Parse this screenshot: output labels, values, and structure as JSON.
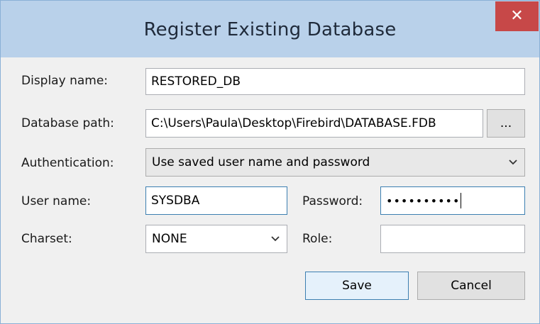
{
  "window": {
    "title": "Register Existing Database",
    "close_icon": "close-icon"
  },
  "form": {
    "display_name": {
      "label": "Display name:",
      "value": "RESTORED_DB"
    },
    "database_path": {
      "label": "Database path:",
      "value": "C:\\Users\\Paula\\Desktop\\Firebird\\DATABASE.FDB",
      "browse_label": "..."
    },
    "authentication": {
      "label": "Authentication:",
      "selected": "Use saved user name and password"
    },
    "user_name": {
      "label": "User name:",
      "value": "SYSDBA"
    },
    "password": {
      "label": "Password:",
      "value": "••••••••••"
    },
    "charset": {
      "label": "Charset:",
      "selected": "NONE"
    },
    "role": {
      "label": "Role:",
      "value": ""
    }
  },
  "buttons": {
    "save": "Save",
    "cancel": "Cancel"
  },
  "colors": {
    "titlebar": "#b9d1ea",
    "close_button": "#c74848",
    "dialog_background": "#f0f0f0",
    "focus_border": "#3c7fb1"
  }
}
